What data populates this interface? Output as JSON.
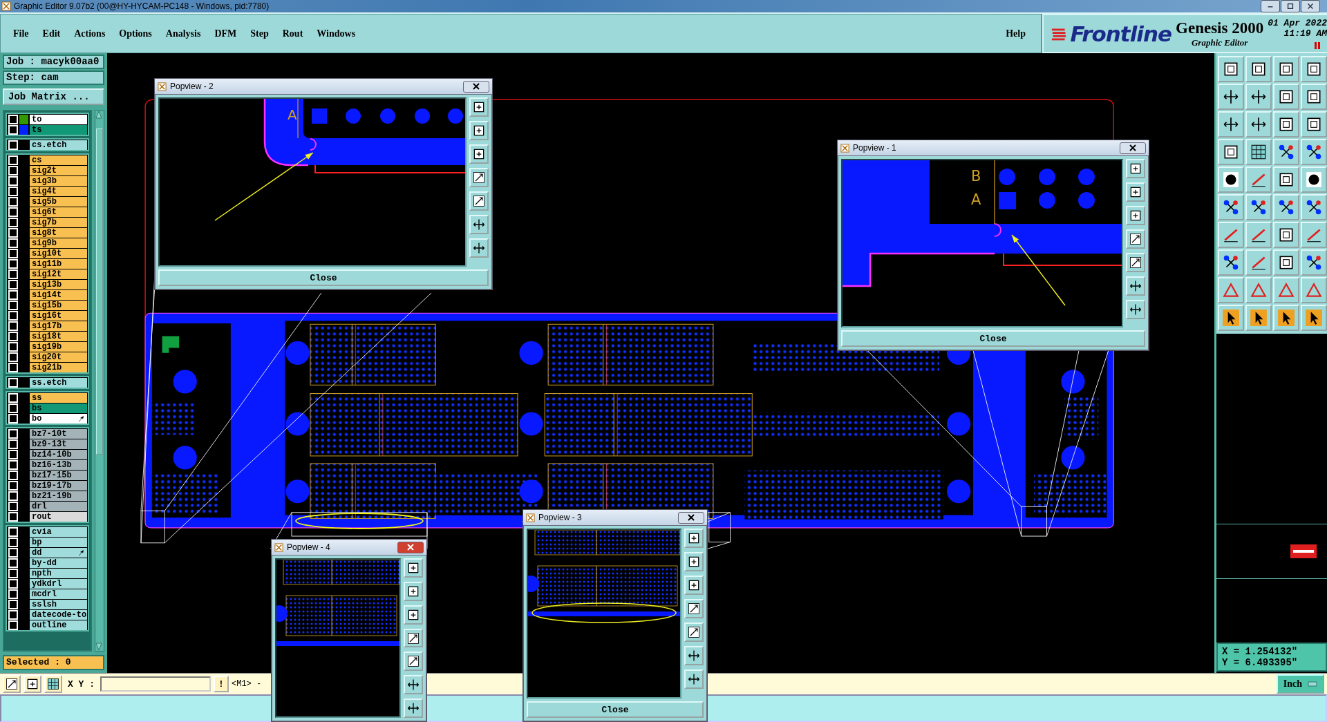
{
  "window": {
    "title": "Graphic Editor 9.07b2 (00@HY-HYCAM-PC148 - Windows, pid:7780)"
  },
  "menu": [
    {
      "label": "File"
    },
    {
      "label": "Edit"
    },
    {
      "label": "Actions"
    },
    {
      "label": "Options"
    },
    {
      "label": "Analysis"
    },
    {
      "label": "DFM"
    },
    {
      "label": "Step"
    },
    {
      "label": "Rout"
    },
    {
      "label": "Windows"
    }
  ],
  "help": "Help",
  "brand": {
    "logo": "Frontline",
    "product": "Genesis 2000",
    "subtitle": "Graphic Editor",
    "date": "01 Apr 2022",
    "time": "11:19 AM"
  },
  "job": {
    "job": "Job : macyk00aa0",
    "step": "Step: cam",
    "matrix_button": "Job Matrix ..."
  },
  "layer_groups": [
    [
      {
        "name": "to",
        "color": "#ffffff",
        "swatch": {
          "color": "#339900"
        },
        "checked": false,
        "pointer": false
      },
      {
        "name": "ts",
        "color": "#119977",
        "swatch": {
          "color": "#0022ff"
        },
        "checked": false,
        "pointer": false
      }
    ],
    [
      {
        "name": "cs.etch",
        "color": "#a0dcdc",
        "checked": false,
        "pointer": false
      }
    ],
    [
      {
        "name": "cs",
        "color": "#f8c050",
        "checked": false,
        "pointer": false
      },
      {
        "name": "sig2t",
        "color": "#f8c050",
        "checked": false,
        "pointer": false
      },
      {
        "name": "sig3b",
        "color": "#f8c050",
        "checked": false,
        "pointer": false
      },
      {
        "name": "sig4t",
        "color": "#f8c050",
        "checked": false,
        "pointer": false
      },
      {
        "name": "sig5b",
        "color": "#f8c050",
        "checked": false,
        "pointer": false
      },
      {
        "name": "sig6t",
        "color": "#f8c050",
        "checked": false,
        "pointer": false
      },
      {
        "name": "sig7b",
        "color": "#f8c050",
        "checked": false,
        "pointer": false
      },
      {
        "name": "sig8t",
        "color": "#f8c050",
        "checked": false,
        "pointer": false
      },
      {
        "name": "sig9b",
        "color": "#f8c050",
        "checked": false,
        "pointer": false
      },
      {
        "name": "sig10t",
        "color": "#f8c050",
        "checked": false,
        "pointer": false
      },
      {
        "name": "sig11b",
        "color": "#f8c050",
        "checked": false,
        "pointer": false
      },
      {
        "name": "sig12t",
        "color": "#f8c050",
        "checked": false,
        "pointer": false
      },
      {
        "name": "sig13b",
        "color": "#f8c050",
        "checked": false,
        "pointer": false
      },
      {
        "name": "sig14t",
        "color": "#f8c050",
        "checked": false,
        "pointer": false
      },
      {
        "name": "sig15b",
        "color": "#f8c050",
        "checked": false,
        "pointer": false
      },
      {
        "name": "sig16t",
        "color": "#f8c050",
        "checked": false,
        "pointer": false
      },
      {
        "name": "sig17b",
        "color": "#f8c050",
        "checked": false,
        "pointer": false
      },
      {
        "name": "sig18t",
        "color": "#f8c050",
        "checked": false,
        "pointer": false
      },
      {
        "name": "sig19b",
        "color": "#f8c050",
        "checked": false,
        "pointer": false
      },
      {
        "name": "sig20t",
        "color": "#f8c050",
        "checked": false,
        "pointer": false
      },
      {
        "name": "sig21b",
        "color": "#f8c050",
        "checked": false,
        "pointer": false
      }
    ],
    [
      {
        "name": "ss.etch",
        "color": "#a0dcdc",
        "checked": false,
        "pointer": false
      }
    ],
    [
      {
        "name": "ss",
        "color": "#f8c050",
        "checked": false,
        "pointer": false
      },
      {
        "name": "bs",
        "color": "#119977",
        "checked": false,
        "pointer": false
      },
      {
        "name": "bo",
        "color": "#ffffff",
        "checked": false,
        "pointer": true
      }
    ],
    [
      {
        "name": "bz7-10t",
        "color": "#a3b3b8",
        "checked": false,
        "pointer": false
      },
      {
        "name": "bz9-13t",
        "color": "#a3b3b8",
        "checked": false,
        "pointer": false
      },
      {
        "name": "bz14-10b",
        "color": "#a3b3b8",
        "checked": false,
        "pointer": false
      },
      {
        "name": "bz16-13b",
        "color": "#a3b3b8",
        "checked": false,
        "pointer": false
      },
      {
        "name": "bz17-15b",
        "color": "#a3b3b8",
        "checked": false,
        "pointer": false
      },
      {
        "name": "bz19-17b",
        "color": "#a3b3b8",
        "checked": false,
        "pointer": false
      },
      {
        "name": "bz21-19b",
        "color": "#a3b3b8",
        "checked": false,
        "pointer": false
      },
      {
        "name": "drl",
        "color": "#a3b3b8",
        "checked": false,
        "pointer": false
      },
      {
        "name": "rout",
        "color": "#dadada",
        "checked": false,
        "pointer": false
      }
    ],
    [
      {
        "name": "cvia",
        "color": "#a0dcdc",
        "checked": false,
        "pointer": false
      },
      {
        "name": "bp",
        "color": "#a0dcdc",
        "checked": false,
        "pointer": false
      },
      {
        "name": "dd",
        "color": "#a0dcdc",
        "checked": false,
        "pointer": true
      },
      {
        "name": "by-dd",
        "color": "#a0dcdc",
        "checked": false,
        "pointer": false
      },
      {
        "name": "npth",
        "color": "#a0dcdc",
        "checked": false,
        "pointer": false
      },
      {
        "name": "ydkdrl",
        "color": "#a0dcdc",
        "checked": false,
        "pointer": false
      },
      {
        "name": "mcdrl",
        "color": "#a0dcdc",
        "checked": false,
        "pointer": false
      },
      {
        "name": "sslsh",
        "color": "#a0dcdc",
        "checked": false,
        "pointer": false
      },
      {
        "name": "datecode-to",
        "color": "#a0dcdc",
        "checked": false,
        "pointer": false
      },
      {
        "name": "outline",
        "color": "#a0dcdc",
        "checked": false,
        "pointer": false
      }
    ]
  ],
  "selected": "Selected : 0",
  "coordinates": {
    "x": "X = 1.254132\"",
    "y": "Y = 6.493395\""
  },
  "bottom": {
    "xy_label": "X Y :",
    "mark_button": "!",
    "mouse_hint": "<M1> -",
    "units": "Inch"
  },
  "popviews": [
    {
      "title": "Popview - 2",
      "kind": "corner",
      "labels": [
        "A"
      ],
      "close": "Close"
    },
    {
      "title": "Popview - 1",
      "kind": "edge",
      "labels": [
        "B",
        "A"
      ],
      "close": "Close"
    },
    {
      "title": "Popview - 3",
      "kind": "connector",
      "highlight": true,
      "close": "Close"
    },
    {
      "title": "Popview - 4",
      "kind": "connector"
    }
  ]
}
